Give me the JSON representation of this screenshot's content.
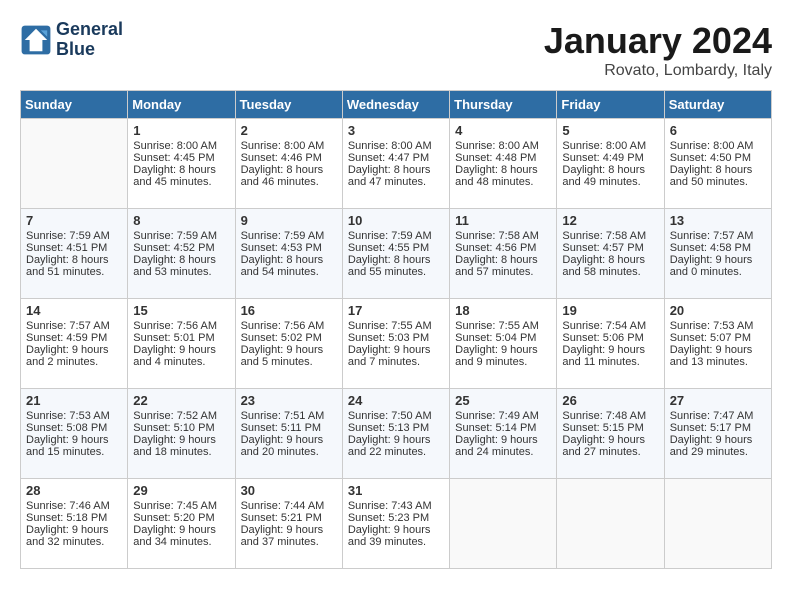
{
  "header": {
    "logo_line1": "General",
    "logo_line2": "Blue",
    "month": "January 2024",
    "location": "Rovato, Lombardy, Italy"
  },
  "weekdays": [
    "Sunday",
    "Monday",
    "Tuesday",
    "Wednesday",
    "Thursday",
    "Friday",
    "Saturday"
  ],
  "weeks": [
    [
      {
        "day": "",
        "content": ""
      },
      {
        "day": "1",
        "content": "Sunrise: 8:00 AM\nSunset: 4:45 PM\nDaylight: 8 hours\nand 45 minutes."
      },
      {
        "day": "2",
        "content": "Sunrise: 8:00 AM\nSunset: 4:46 PM\nDaylight: 8 hours\nand 46 minutes."
      },
      {
        "day": "3",
        "content": "Sunrise: 8:00 AM\nSunset: 4:47 PM\nDaylight: 8 hours\nand 47 minutes."
      },
      {
        "day": "4",
        "content": "Sunrise: 8:00 AM\nSunset: 4:48 PM\nDaylight: 8 hours\nand 48 minutes."
      },
      {
        "day": "5",
        "content": "Sunrise: 8:00 AM\nSunset: 4:49 PM\nDaylight: 8 hours\nand 49 minutes."
      },
      {
        "day": "6",
        "content": "Sunrise: 8:00 AM\nSunset: 4:50 PM\nDaylight: 8 hours\nand 50 minutes."
      }
    ],
    [
      {
        "day": "7",
        "content": "Sunrise: 7:59 AM\nSunset: 4:51 PM\nDaylight: 8 hours\nand 51 minutes."
      },
      {
        "day": "8",
        "content": "Sunrise: 7:59 AM\nSunset: 4:52 PM\nDaylight: 8 hours\nand 53 minutes."
      },
      {
        "day": "9",
        "content": "Sunrise: 7:59 AM\nSunset: 4:53 PM\nDaylight: 8 hours\nand 54 minutes."
      },
      {
        "day": "10",
        "content": "Sunrise: 7:59 AM\nSunset: 4:55 PM\nDaylight: 8 hours\nand 55 minutes."
      },
      {
        "day": "11",
        "content": "Sunrise: 7:58 AM\nSunset: 4:56 PM\nDaylight: 8 hours\nand 57 minutes."
      },
      {
        "day": "12",
        "content": "Sunrise: 7:58 AM\nSunset: 4:57 PM\nDaylight: 8 hours\nand 58 minutes."
      },
      {
        "day": "13",
        "content": "Sunrise: 7:57 AM\nSunset: 4:58 PM\nDaylight: 9 hours\nand 0 minutes."
      }
    ],
    [
      {
        "day": "14",
        "content": "Sunrise: 7:57 AM\nSunset: 4:59 PM\nDaylight: 9 hours\nand 2 minutes."
      },
      {
        "day": "15",
        "content": "Sunrise: 7:56 AM\nSunset: 5:01 PM\nDaylight: 9 hours\nand 4 minutes."
      },
      {
        "day": "16",
        "content": "Sunrise: 7:56 AM\nSunset: 5:02 PM\nDaylight: 9 hours\nand 5 minutes."
      },
      {
        "day": "17",
        "content": "Sunrise: 7:55 AM\nSunset: 5:03 PM\nDaylight: 9 hours\nand 7 minutes."
      },
      {
        "day": "18",
        "content": "Sunrise: 7:55 AM\nSunset: 5:04 PM\nDaylight: 9 hours\nand 9 minutes."
      },
      {
        "day": "19",
        "content": "Sunrise: 7:54 AM\nSunset: 5:06 PM\nDaylight: 9 hours\nand 11 minutes."
      },
      {
        "day": "20",
        "content": "Sunrise: 7:53 AM\nSunset: 5:07 PM\nDaylight: 9 hours\nand 13 minutes."
      }
    ],
    [
      {
        "day": "21",
        "content": "Sunrise: 7:53 AM\nSunset: 5:08 PM\nDaylight: 9 hours\nand 15 minutes."
      },
      {
        "day": "22",
        "content": "Sunrise: 7:52 AM\nSunset: 5:10 PM\nDaylight: 9 hours\nand 18 minutes."
      },
      {
        "day": "23",
        "content": "Sunrise: 7:51 AM\nSunset: 5:11 PM\nDaylight: 9 hours\nand 20 minutes."
      },
      {
        "day": "24",
        "content": "Sunrise: 7:50 AM\nSunset: 5:13 PM\nDaylight: 9 hours\nand 22 minutes."
      },
      {
        "day": "25",
        "content": "Sunrise: 7:49 AM\nSunset: 5:14 PM\nDaylight: 9 hours\nand 24 minutes."
      },
      {
        "day": "26",
        "content": "Sunrise: 7:48 AM\nSunset: 5:15 PM\nDaylight: 9 hours\nand 27 minutes."
      },
      {
        "day": "27",
        "content": "Sunrise: 7:47 AM\nSunset: 5:17 PM\nDaylight: 9 hours\nand 29 minutes."
      }
    ],
    [
      {
        "day": "28",
        "content": "Sunrise: 7:46 AM\nSunset: 5:18 PM\nDaylight: 9 hours\nand 32 minutes."
      },
      {
        "day": "29",
        "content": "Sunrise: 7:45 AM\nSunset: 5:20 PM\nDaylight: 9 hours\nand 34 minutes."
      },
      {
        "day": "30",
        "content": "Sunrise: 7:44 AM\nSunset: 5:21 PM\nDaylight: 9 hours\nand 37 minutes."
      },
      {
        "day": "31",
        "content": "Sunrise: 7:43 AM\nSunset: 5:23 PM\nDaylight: 9 hours\nand 39 minutes."
      },
      {
        "day": "",
        "content": ""
      },
      {
        "day": "",
        "content": ""
      },
      {
        "day": "",
        "content": ""
      }
    ]
  ]
}
